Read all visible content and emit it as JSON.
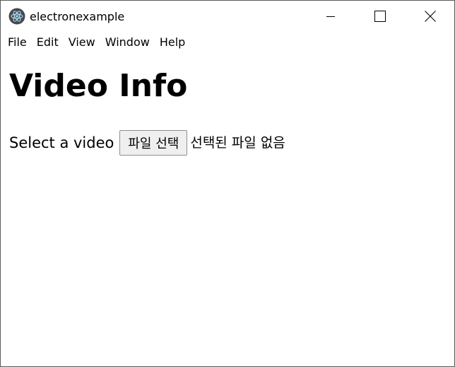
{
  "window": {
    "title": "electronexample",
    "icon": "electron-atom-icon",
    "controls": {
      "minimize": "minimize-icon",
      "maximize": "maximize-icon",
      "close": "close-icon"
    }
  },
  "menu": {
    "items": [
      {
        "label": "File"
      },
      {
        "label": "Edit"
      },
      {
        "label": "View"
      },
      {
        "label": "Window"
      },
      {
        "label": "Help"
      }
    ]
  },
  "page": {
    "title": "Video Info",
    "file_input": {
      "label": "Select a video",
      "button_label": "파일 선택",
      "status": "선택된 파일 없음"
    }
  },
  "colors": {
    "window_border": "#5a5a5a",
    "icon_dark": "#47484f",
    "button_bg": "#efefef",
    "button_border": "#8f8f8f"
  }
}
